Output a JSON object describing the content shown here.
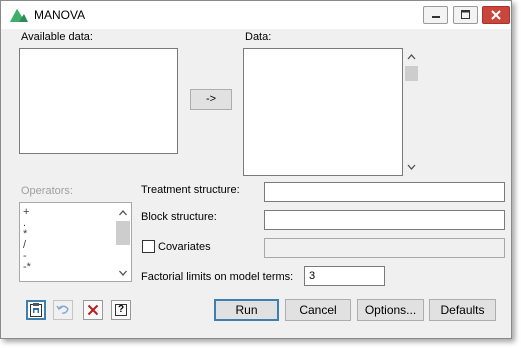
{
  "window": {
    "title": "MANOVA"
  },
  "available_data": {
    "label": "Available data:"
  },
  "move_button": {
    "label": "->"
  },
  "data": {
    "label": "Data:"
  },
  "operators": {
    "label": "Operators:",
    "items": [
      "+",
      ".",
      "*",
      "/",
      "-",
      "-*"
    ]
  },
  "treatment": {
    "label": "Treatment structure:",
    "value": ""
  },
  "block": {
    "label": "Block structure:",
    "value": ""
  },
  "covariates": {
    "label": "Covariates",
    "checked": false,
    "value": ""
  },
  "factorial": {
    "label": "Factorial limits on model terms:",
    "value": "3"
  },
  "buttons": {
    "run": "Run",
    "cancel": "Cancel",
    "options": "Options...",
    "defaults": "Defaults"
  },
  "toolbar": {
    "help_label": "?"
  },
  "colors": {
    "accent": "#3c7fb1",
    "close": "#c9463d",
    "window_bg": "#f0f0f0"
  }
}
